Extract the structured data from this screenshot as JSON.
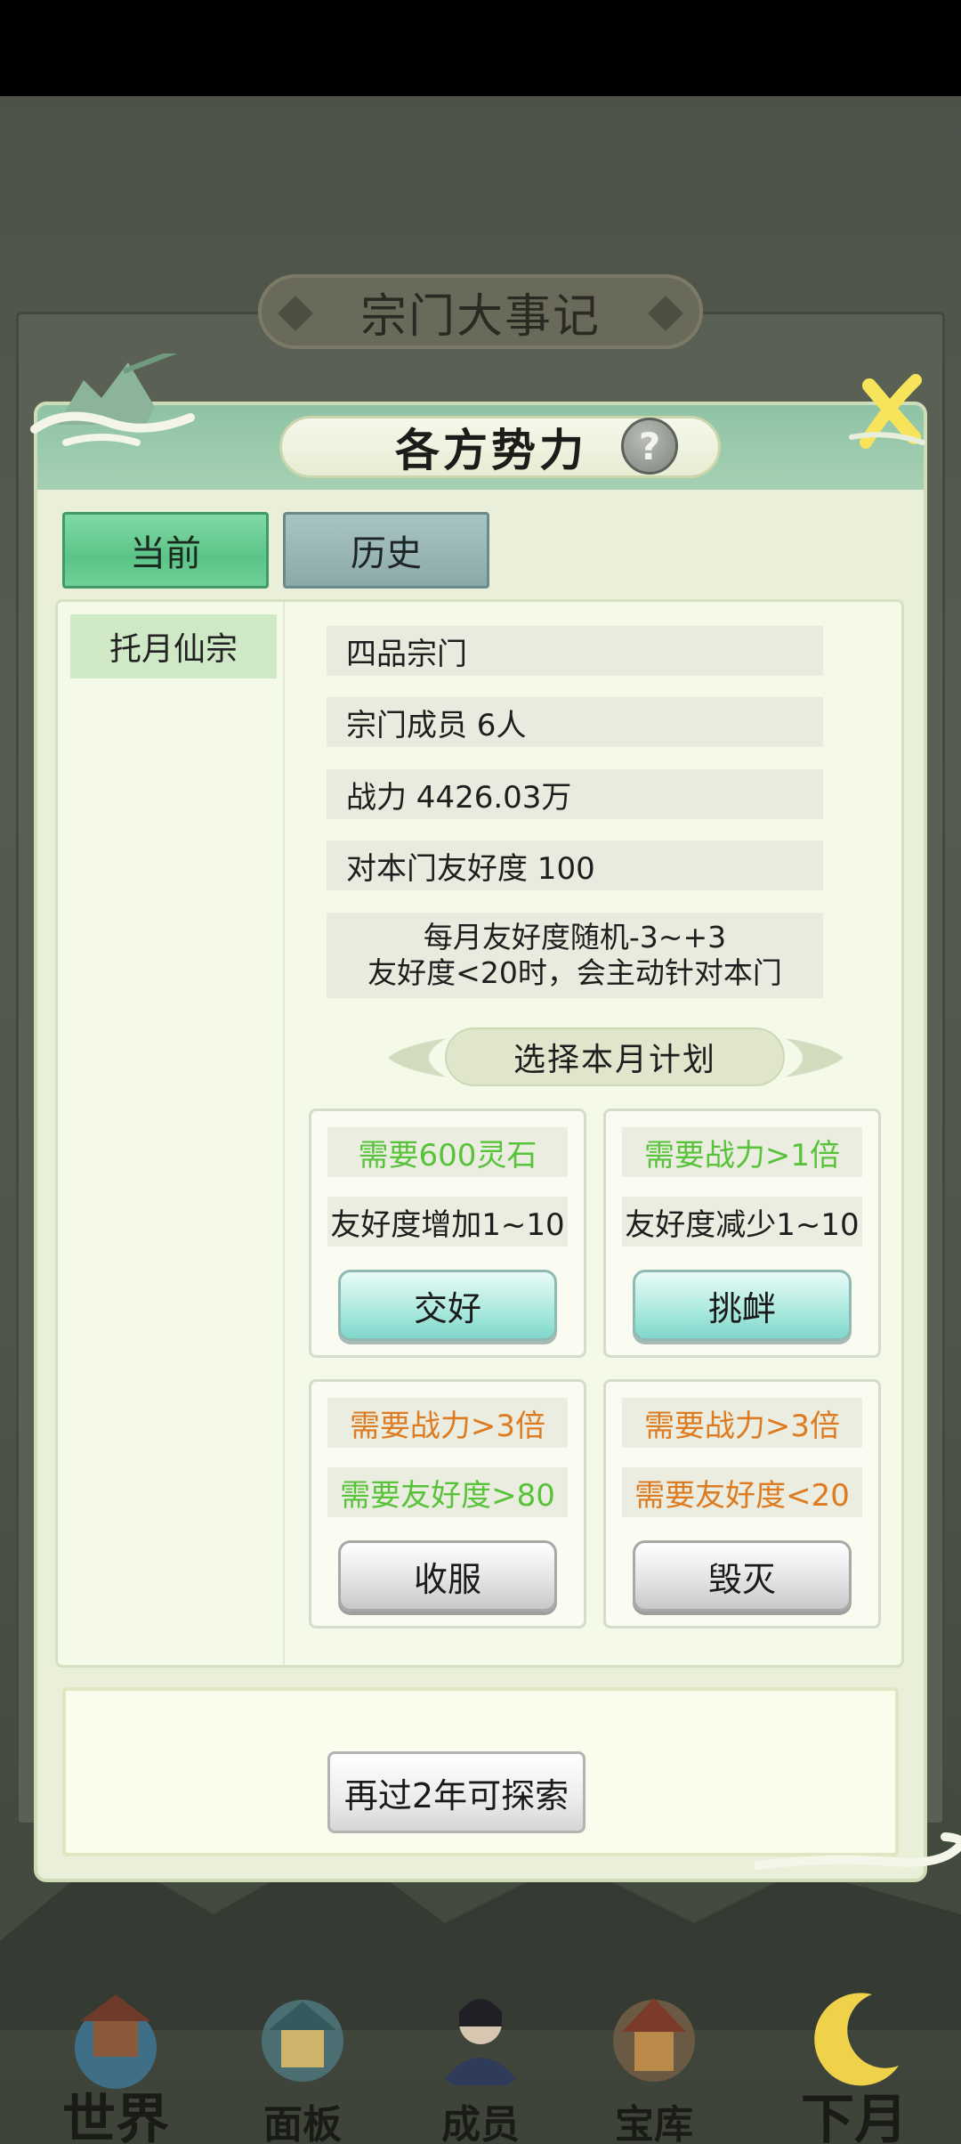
{
  "background": {
    "header_title": "宗门大事记"
  },
  "modal": {
    "title": "各方势力",
    "help_symbol": "?",
    "tabs": [
      {
        "label": "当前",
        "selected": true
      },
      {
        "label": "历史",
        "selected": false
      }
    ],
    "sect_list": [
      "托月仙宗"
    ],
    "info": {
      "rank": "四品宗门",
      "members": "宗门成员 6人",
      "power": "战力 4426.03万",
      "friendship": "对本门友好度 100",
      "note_line1": "每月友好度随机-3~+3",
      "note_line2": "友好度<20时，会主动针对本门"
    },
    "plan_title": "选择本月计划",
    "plans": [
      {
        "req1": "需要600灵石",
        "req2": "友好度增加1~10",
        "button": "交好"
      },
      {
        "req1": "需要战力>1倍",
        "req2": "友好度减少1~10",
        "button": "挑衅"
      },
      {
        "req1": "需要战力>3倍",
        "req2": "需要友好度>80",
        "button": "收服"
      },
      {
        "req1": "需要战力>3倍",
        "req2": "需要友好度<20",
        "button": "毁灭"
      }
    ],
    "explore_button": "再过2年可探索"
  },
  "bottom_nav": [
    {
      "label": "世界",
      "icon": "world-icon"
    },
    {
      "label": "面板",
      "icon": "panel-icon"
    },
    {
      "label": "成员",
      "icon": "members-icon"
    },
    {
      "label": "宝库",
      "icon": "treasury-icon"
    },
    {
      "label": "下月",
      "icon": "next-month-icon"
    }
  ],
  "colors": {
    "requirement_met": "#58c23a",
    "requirement_unmet": "#de7a1f",
    "tab_active": "#5cc488"
  }
}
